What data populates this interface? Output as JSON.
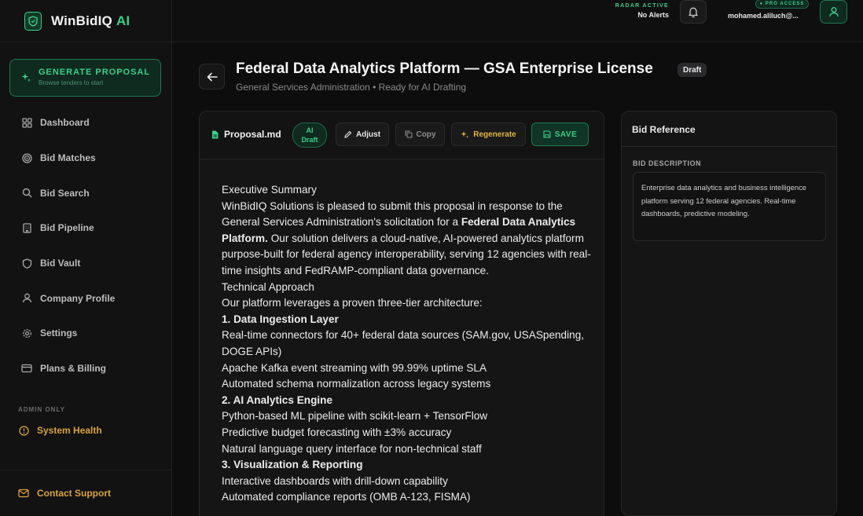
{
  "app": {
    "name": "WinBidIQ",
    "name_suffix": "AI"
  },
  "sidebar": {
    "generate": {
      "title": "GENERATE PROPOSAL",
      "subtitle": "Browse tenders to start"
    },
    "items": [
      {
        "label": "Dashboard",
        "icon": "grid-icon"
      },
      {
        "label": "Bid Matches",
        "icon": "target-icon"
      },
      {
        "label": "Bid Search",
        "icon": "search-icon"
      },
      {
        "label": "Bid Pipeline",
        "icon": "building-icon"
      },
      {
        "label": "Bid Vault",
        "icon": "shield-icon"
      },
      {
        "label": "Company Profile",
        "icon": "user-icon"
      },
      {
        "label": "Settings",
        "icon": "gear-icon"
      },
      {
        "label": "Plans & Billing",
        "icon": "card-icon"
      }
    ],
    "admin_label": "ADMIN ONLY",
    "system_health": "System Health",
    "contact_support": "Contact Support"
  },
  "topbar": {
    "radar_label": "RADAR ACTIVE",
    "radar_status": "No Alerts",
    "pro_badge": "● PRO ACCESS",
    "user_email": "mohamed.aliluch@..."
  },
  "header": {
    "title": "Federal Data Analytics Platform — GSA Enterprise License",
    "status_badge": "Draft",
    "subtitle": "General Services Administration • Ready for AI Drafting"
  },
  "editor": {
    "file_name": "Proposal.md",
    "ai_badge_line1": "AI",
    "ai_badge_line2": "Draft",
    "adjust_label": "Adjust",
    "copy_label": "Copy",
    "regenerate_label": "Regenerate",
    "save_label": "SAVE",
    "doc": {
      "exec_heading": "Executive Summary",
      "exec_p1": "WinBidIQ Solutions is pleased to submit this proposal in response to the General Services Administration's solicitation for a ",
      "exec_bold": "Federal Data Analytics Platform.",
      "exec_p2": " Our solution delivers a cloud-native, AI-powered analytics platform purpose-built for federal agency interoperability, serving 12 agencies with real-time insights and FedRAMP-compliant data governance.",
      "tech_heading": "Technical Approach",
      "tech_intro": "Our platform leverages a proven three-tier architecture:",
      "s1_title": "1. Data Ingestion Layer",
      "s1_l1": "Real-time connectors for 40+ federal data sources (SAM.gov, USASpending, DOGE APIs)",
      "s1_l2": "Apache Kafka event streaming with 99.99% uptime SLA",
      "s1_l3": "Automated schema normalization across legacy systems",
      "s2_title": "2. AI Analytics Engine",
      "s2_l1": "Python-based ML pipeline with scikit-learn + TensorFlow",
      "s2_l2": "Predictive budget forecasting with ±3% accuracy",
      "s2_l3": "Natural language query interface for non-technical staff",
      "s3_title": "3. Visualization & Reporting",
      "s3_l1": "Interactive dashboards with drill-down capability",
      "s3_l2": "Automated compliance reports (OMB A-123, FISMA)"
    }
  },
  "reference": {
    "title": "Bid Reference",
    "desc_label": "BID DESCRIPTION",
    "desc_text": "Enterprise data analytics and business intelligence platform serving 12 federal agencies. Real-time dashboards, predictive modeling."
  },
  "colors": {
    "accent": "#3ad08a",
    "warning": "#d9a33a",
    "background": "#0d0d0e"
  }
}
